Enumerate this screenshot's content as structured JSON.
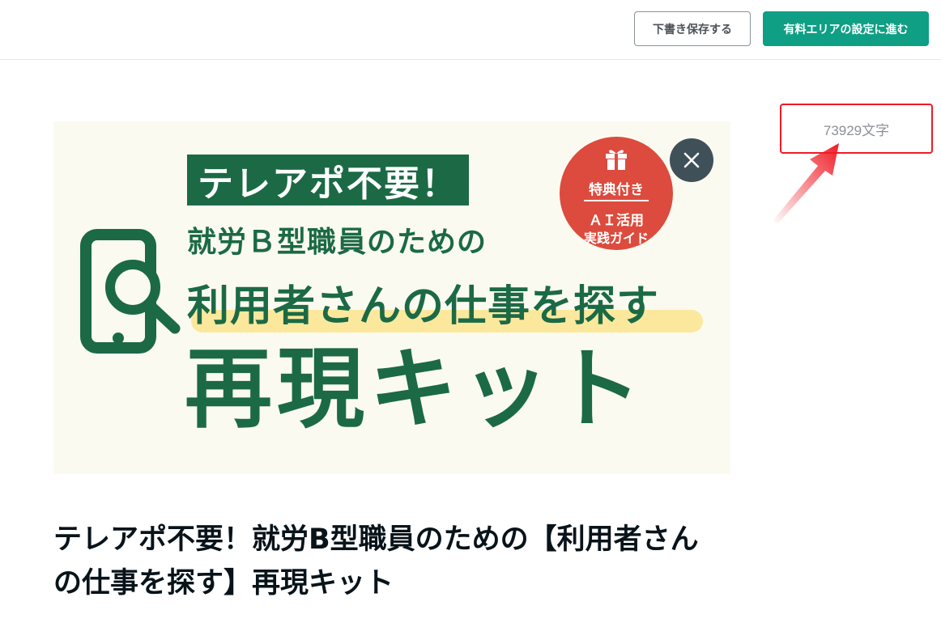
{
  "toolbar": {
    "draft_label": "下書き保存する",
    "paid_area_label": "有料エリアの設定に進む"
  },
  "editor": {
    "char_count": "73929文字",
    "title": "テレアポ不要！就労B型職員のための【利用者さんの仕事を探す】再現キット"
  },
  "hero_image": {
    "banner": "テレアポ不要！",
    "subtitle": "就労Ｂ型職員のための",
    "main_line": "利用者さんの仕事を探す",
    "big_text": "再現キット",
    "badge": {
      "line1": "特典付き",
      "line2": "ＡＩ活用",
      "line3": "実践ガイド"
    },
    "icons": [
      "phone-search-icon",
      "gift-icon"
    ]
  },
  "colors": {
    "accent": "#0f9f84",
    "brand_green": "#1b6a45",
    "badge_red": "#dc4b3d",
    "highlight_yellow": "#fbe89c",
    "annotation_red": "#ee1c24"
  }
}
